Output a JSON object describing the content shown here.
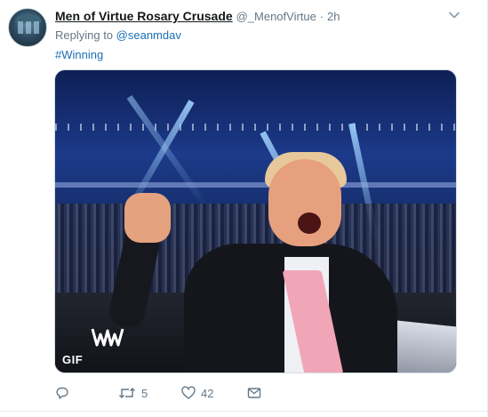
{
  "tweet": {
    "author_name": "Men of Virtue Rosary Crusade",
    "author_handle": "@_MenofVirtue",
    "separator": "·",
    "time": "2h",
    "replying_prefix": "Replying to",
    "replying_to": "@seanmdav",
    "text": "#Winning"
  },
  "media": {
    "type_badge": "GIF",
    "logo": "wwe-logo"
  },
  "actions": {
    "reply_count": "",
    "retweet_count": "5",
    "like_count": "42"
  },
  "icons": {
    "reply": "reply-icon",
    "retweet": "retweet-icon",
    "like": "heart-icon",
    "dm": "envelope-icon",
    "more": "chevron-down-icon"
  },
  "colors": {
    "link": "#1b6fb5",
    "muted": "#657786",
    "text": "#14171a"
  }
}
